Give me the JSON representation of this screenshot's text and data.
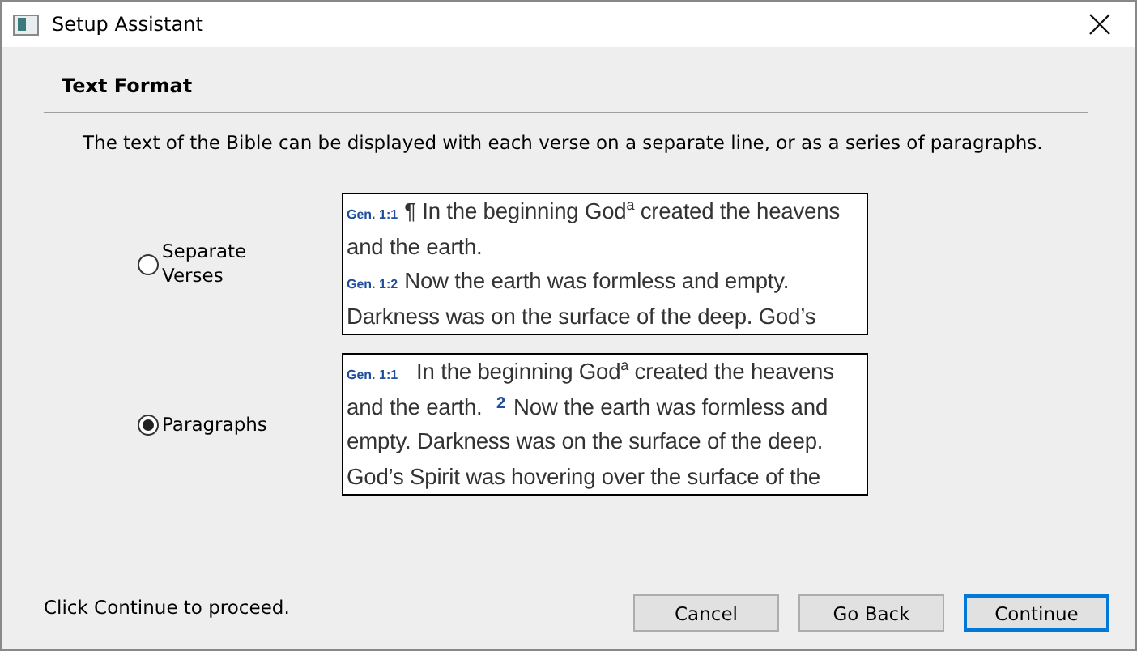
{
  "window": {
    "title": "Setup Assistant"
  },
  "heading": "Text Format",
  "description": "The text of the Bible can be displayed with each verse on a separate line, or as a series of paragraphs.",
  "options": [
    {
      "label": "Separate Verses",
      "selected": false,
      "preview": [
        [
          {
            "kind": "ref",
            "text": "Gen. 1:1"
          },
          {
            "kind": "text",
            "text": "¶ In the beginning God$^{a}$ created the heavens"
          }
        ],
        [
          {
            "kind": "text",
            "text": "and the earth."
          }
        ],
        [
          {
            "kind": "ref",
            "text": "Gen. 1:2"
          },
          {
            "kind": "text",
            "text": "Now the earth was formless and empty."
          }
        ],
        [
          {
            "kind": "text",
            "text": "Darkness was on the surface of the deep. God’s"
          }
        ]
      ]
    },
    {
      "label": "Paragraphs",
      "selected": true,
      "preview": [
        [
          {
            "kind": "ref",
            "text": "Gen. 1:1"
          },
          {
            "kind": "text",
            "text": "  In the beginning God$^{a}$ created the heavens"
          }
        ],
        [
          {
            "kind": "text",
            "text": "and the earth. "
          },
          {
            "kind": "number",
            "text": "2"
          },
          {
            "kind": "text",
            "text": "Now the earth was formless and"
          }
        ],
        [
          {
            "kind": "text",
            "text": "empty. Darkness was on the surface of the deep."
          }
        ],
        [
          {
            "kind": "text",
            "text": "God’s Spirit was hovering over the surface of the"
          }
        ]
      ]
    }
  ],
  "status": "Click Continue to proceed.",
  "buttons": [
    {
      "label": "Cancel",
      "default": false
    },
    {
      "label": "Go Back",
      "default": false
    },
    {
      "label": "Continue",
      "default": true
    }
  ]
}
